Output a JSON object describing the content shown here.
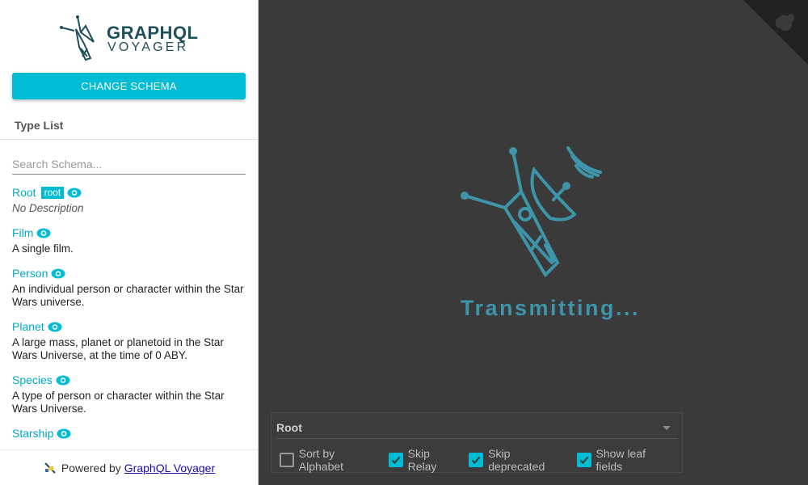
{
  "sidebar": {
    "logo_line1": "GRAPHQL",
    "logo_line2": "VOYAGER",
    "change_schema_label": "CHANGE SCHEMA",
    "type_list_title": "Type List",
    "search_placeholder": "Search Schema...",
    "types": [
      {
        "name": "Root",
        "badge": "root",
        "description": "No Description"
      },
      {
        "name": "Film",
        "description": "A single film."
      },
      {
        "name": "Person",
        "description": "An individual person or character within the Star Wars universe."
      },
      {
        "name": "Planet",
        "description": "A large mass, planet or planetoid in the Star Wars Universe, at the time of 0 ABY."
      },
      {
        "name": "Species",
        "description": "A type of person or character within the Star Wars Universe."
      },
      {
        "name": "Starship",
        "description": ""
      }
    ],
    "footer": {
      "prefix": "Powered by",
      "link": "GraphQL Voyager"
    }
  },
  "main": {
    "loading_text": "Transmitting...",
    "root_select_value": "Root",
    "options": [
      {
        "label": "Sort by Alphabet",
        "checked": false
      },
      {
        "label": "Skip Relay",
        "checked": true
      },
      {
        "label": "Skip deprecated",
        "checked": true
      },
      {
        "label": "Show leaf fields",
        "checked": true
      }
    ]
  },
  "colors": {
    "accent": "#00bcd4",
    "link": "#00a8c7",
    "loader": "#3e94a8",
    "background": "#3a3a3a"
  }
}
